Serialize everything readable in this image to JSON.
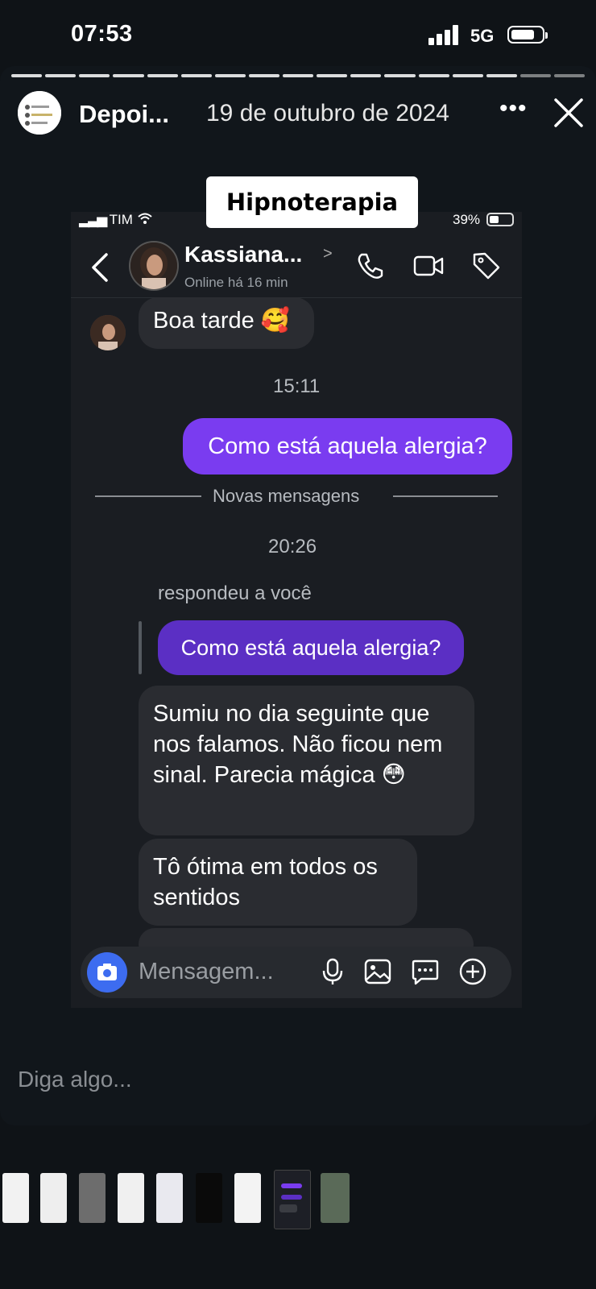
{
  "status_bar": {
    "time": "07:53",
    "network": "5G"
  },
  "story": {
    "author": "Depoi...",
    "date": "19 de outubro de 2024",
    "sticker": "Hipnoterapia",
    "reply_placeholder": "Diga algo..."
  },
  "screenshot": {
    "carrier": "TIM",
    "battery": "39%",
    "contact": {
      "name": "Kassiana...",
      "status": "Online há 16 min"
    },
    "messages": {
      "m1": "Boa tarde 🥰",
      "time1": "15:11",
      "m2": "Como está aquela alergia?",
      "new_messages": "Novas mensagens",
      "time2": "20:26",
      "replied_label": "respondeu a você",
      "quoted": "Como está aquela alergia?",
      "m3": "Sumiu no dia seguinte que nos falamos. Não ficou nem sinal. Parecia mágica 😳",
      "m4": "Tô ótima em todos os sentidos"
    },
    "composer_placeholder": "Mensagem..."
  },
  "icons": {
    "header": [
      "back-arrow-icon",
      "phone-icon",
      "video-camera-icon",
      "tag-icon"
    ],
    "composer": [
      "camera-icon",
      "microphone-icon",
      "image-icon",
      "sticker-chat-icon",
      "plus-icon"
    ]
  },
  "colors": {
    "sent_bubble": "#7a3cf0",
    "camera_button": "#3d6cf0"
  }
}
